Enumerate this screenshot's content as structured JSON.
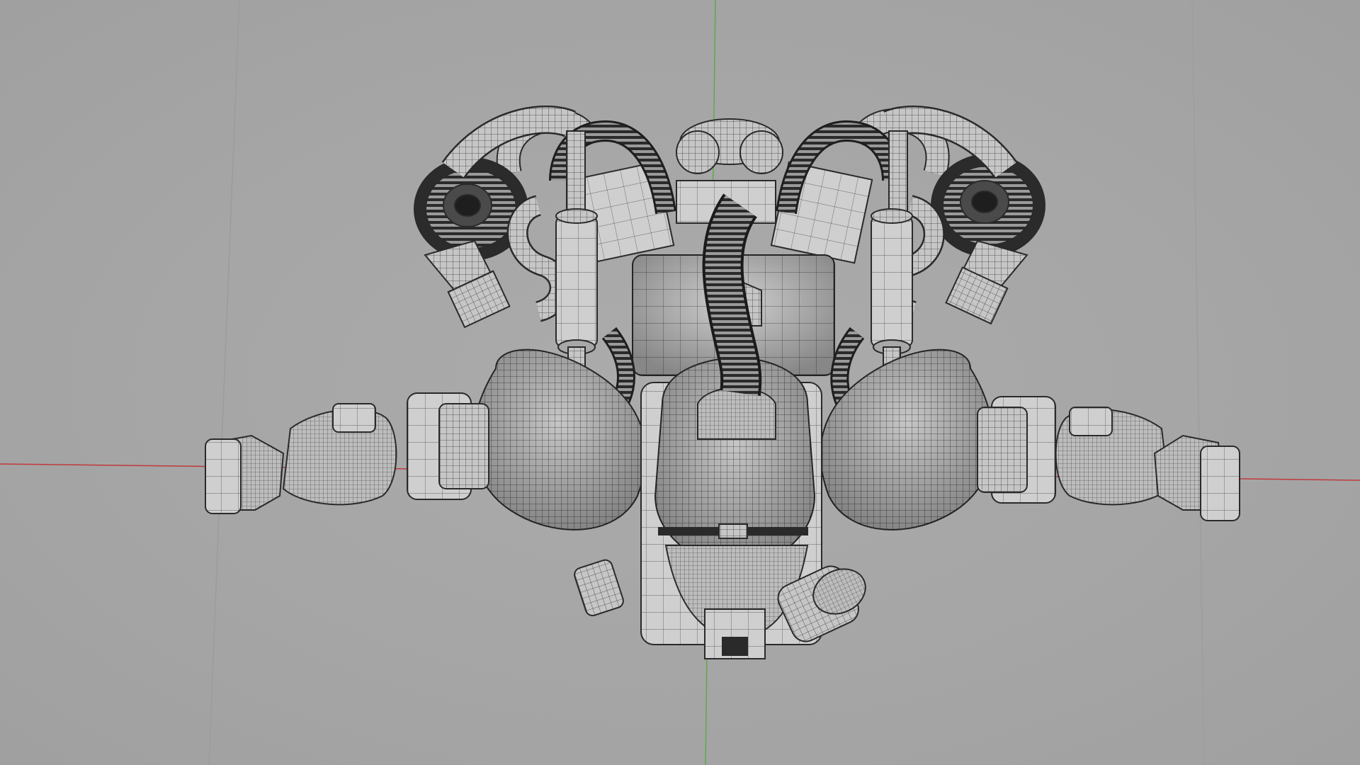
{
  "viewport": {
    "kind": "3d-modeling-viewport",
    "display_mode": "wireframe-on-shaded",
    "background_color": "#a7a7a7",
    "x_axis_color": "#c0393b",
    "y_axis_color": "#5fa84a",
    "grid_line_color": "#9b9b9b",
    "model": {
      "subject": "mech-torso-with-arms-and-hoses",
      "surface_color": "#c9c9c9",
      "wire_color": "#2e2e2e"
    }
  }
}
